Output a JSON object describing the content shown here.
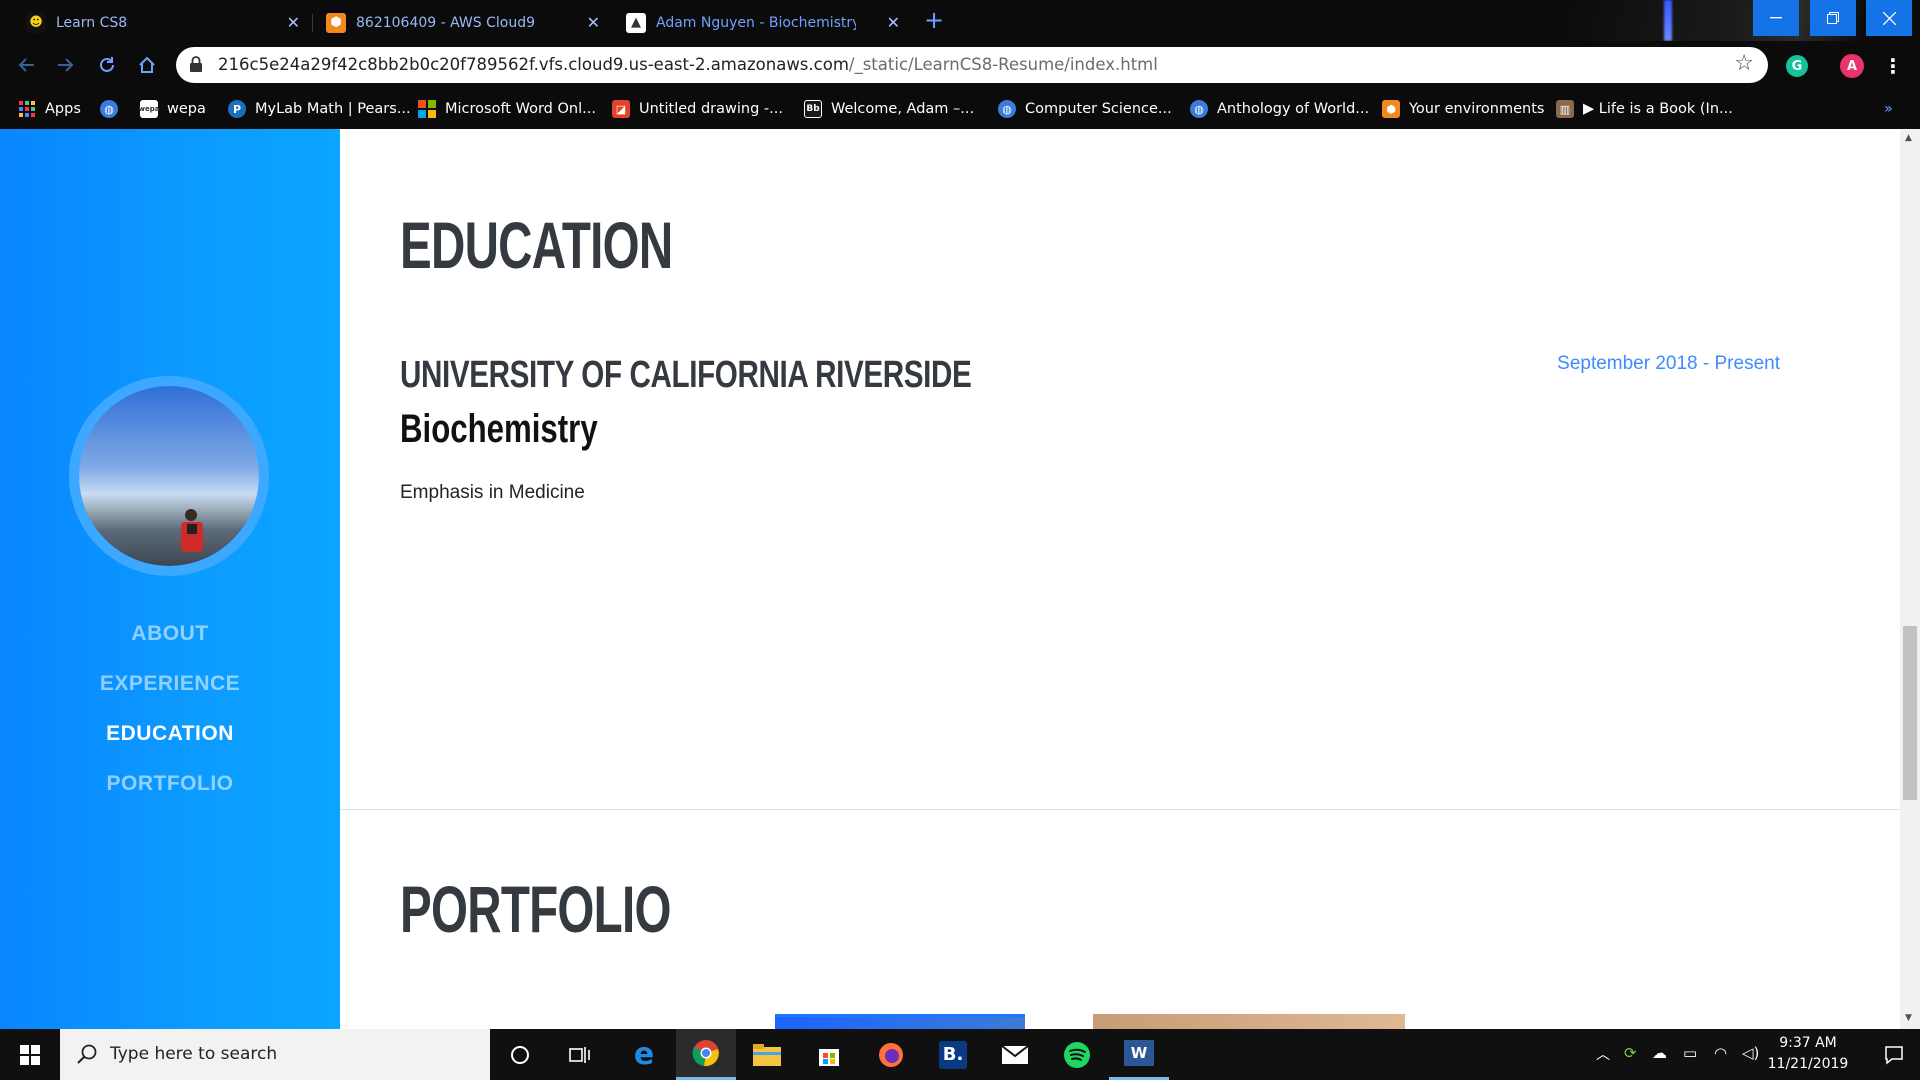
{
  "browser": {
    "tabs": [
      {
        "title": "Learn CS8",
        "active": false
      },
      {
        "title": "862106409 - AWS Cloud9",
        "active": false
      },
      {
        "title": "Adam Nguyen - Biochemistry Ma",
        "active": true
      }
    ],
    "new_tab_label": "+",
    "url_main": "216c5e24a29f42c8bb2b0c20f789562f.vfs.cloud9.us-east-2.amazonaws.com",
    "url_path": "/_static/LearnCS8-Resume/index.html",
    "profile_initial": "A",
    "grammarly_initial": "G",
    "bookmarks": [
      "Apps",
      "wepa",
      "MyLab Math | Pears...",
      "Microsoft Word Onl...",
      "Untitled drawing -...",
      "Welcome, Adam –...",
      "Computer Science...",
      "Anthology of World...",
      "Your environments",
      "▶ Life is a Book (In..."
    ],
    "bookmarks_overflow": "»"
  },
  "page": {
    "nav": [
      "ABOUT",
      "EXPERIENCE",
      "EDUCATION",
      "PORTFOLIO"
    ],
    "active_nav": "EDUCATION",
    "education": {
      "heading": "EDUCATION",
      "school": "UNIVERSITY OF CALIFORNIA RIVERSIDE",
      "degree": "Biochemistry",
      "detail": "Emphasis in Medicine",
      "dates": "September 2018 - Present"
    },
    "portfolio": {
      "heading": "PORTFOLIO"
    },
    "colors": {
      "sidebar": "#0a93ff",
      "heading": "#343a40",
      "date_accent": "#3d8bff"
    }
  },
  "taskbar": {
    "search_placeholder": "Type here to search",
    "time": "9:37 AM",
    "date": "11/21/2019"
  }
}
